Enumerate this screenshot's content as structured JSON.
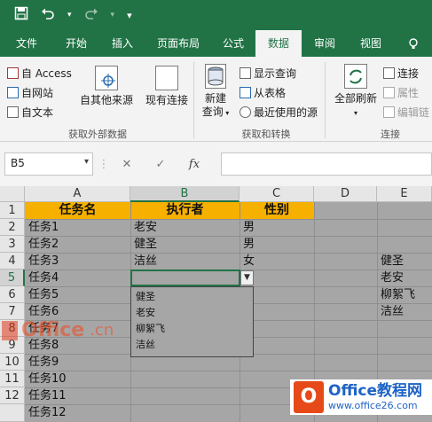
{
  "quick_access": {
    "save_icon": "save-icon",
    "undo_icon": "undo-icon",
    "redo_icon": "redo-icon",
    "customize_icon": "chevron-down-icon"
  },
  "tabs": [
    {
      "label": "文件",
      "active": false
    },
    {
      "label": "开始",
      "active": false
    },
    {
      "label": "插入",
      "active": false
    },
    {
      "label": "页面布局",
      "active": false
    },
    {
      "label": "公式",
      "active": false
    },
    {
      "label": "数据",
      "active": true
    },
    {
      "label": "审阅",
      "active": false
    },
    {
      "label": "视图",
      "active": false
    }
  ],
  "ribbon": {
    "get_external": {
      "label": "获取外部数据",
      "access": "自 Access",
      "web": "自网站",
      "text": "自文本",
      "other_sources": "自其他来源",
      "existing": "现有连接"
    },
    "get_transform": {
      "label": "获取和转换",
      "new_query_1": "新建",
      "new_query_2": "查询",
      "show_queries": "显示查询",
      "from_table": "从表格",
      "recent_sources": "最近使用的源"
    },
    "connections": {
      "label": "连接",
      "refresh_all": "全部刷新",
      "connections": "连接",
      "properties": "属性",
      "edit_links": "编辑链"
    }
  },
  "formula_bar": {
    "name_box": "B5",
    "cancel": "✕",
    "enter": "✓",
    "fx": "fx",
    "value": ""
  },
  "sheet": {
    "columns": [
      "A",
      "B",
      "C",
      "D",
      "E"
    ],
    "selected_column": "B",
    "rows": [
      "1",
      "2",
      "3",
      "4",
      "5",
      "6",
      "7",
      "8",
      "9",
      "10",
      "11",
      "12"
    ],
    "selected_row": "5",
    "header": {
      "a": "任务名",
      "b": "执行者",
      "c": "性别"
    },
    "col_a": [
      "任务1",
      "任务2",
      "任务3",
      "任务4",
      "任务5",
      "任务6",
      "任务7",
      "任务8",
      "任务9",
      "任务10",
      "任务11",
      "任务12"
    ],
    "col_b": [
      "老安",
      "健圣",
      "洁丝"
    ],
    "col_c": [
      "男",
      "男",
      "女"
    ],
    "col_e": [
      "健圣",
      "老安",
      "柳絮飞",
      "洁丝"
    ]
  },
  "dropdown": {
    "options": [
      "健圣",
      "老安",
      "柳絮飞",
      "洁丝"
    ]
  },
  "watermarks": {
    "left_brand": "Office",
    "left_suffix": ".cn",
    "right_title": "Office教程网",
    "right_url": "www.office26.com",
    "logo_letter": "O"
  },
  "colors": {
    "excel_green": "#217346",
    "header_fill": "#f6b000",
    "grid_gray": "#a6a6a6"
  }
}
